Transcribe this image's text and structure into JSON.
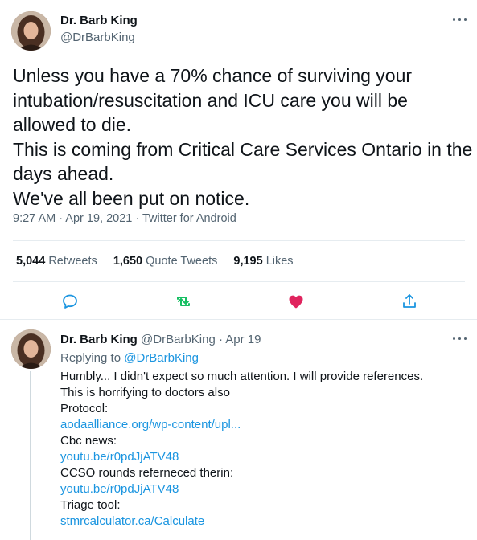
{
  "tweet": {
    "author_name": "Dr. Barb King",
    "author_handle": "@DrBarbKing",
    "text_lines": [
      "Unless you have a 70% chance of surviving your",
      "intubation/resuscitation and ICU care you will be",
      "allowed to die.",
      "This is coming from Critical Care Services Ontario in the",
      "days ahead.",
      "We've all been put on notice."
    ],
    "timestamp": "9:27 AM · Apr 19, 2021 · Twitter for Android",
    "stats": {
      "retweets_count": "5,044",
      "retweets_label": "Retweets",
      "quotes_count": "1,650",
      "quotes_label": "Quote Tweets",
      "likes_count": "9,195",
      "likes_label": "Likes"
    },
    "actions": {
      "reply_icon": "comment-icon",
      "retweet_icon": "retweet-icon",
      "like_icon": "heart-icon",
      "share_icon": "share-icon"
    }
  },
  "reply": {
    "author_name": "Dr. Barb King",
    "author_handle_date": "@DrBarbKing · Apr 19",
    "replying_prefix": "Replying to",
    "replying_handle": "@DrBarbKing",
    "lines": [
      {
        "text": "Humbly... I didn't expect so much attention.  I will provide references.",
        "link": false
      },
      {
        "text": "This is horrifying to doctors also",
        "link": false
      },
      {
        "text": "Protocol:",
        "link": false
      },
      {
        "text": "aodaalliance.org/wp-content/upl...",
        "link": true
      },
      {
        "text": "Cbc news:",
        "link": false
      },
      {
        "text": "youtu.be/r0pdJjATV48",
        "link": true
      },
      {
        "text": "CCSO rounds referneced therin:",
        "link": false
      },
      {
        "text": "youtu.be/r0pdJjATV48",
        "link": true
      },
      {
        "text": "Triage tool:",
        "link": false
      },
      {
        "text": "stmrcalculator.ca/Calculate",
        "link": true
      }
    ]
  },
  "colors": {
    "accent_blue": "#1b95e0",
    "retweet_green": "#17bf63",
    "like_red": "#e0245e",
    "secondary_text": "#536471"
  }
}
